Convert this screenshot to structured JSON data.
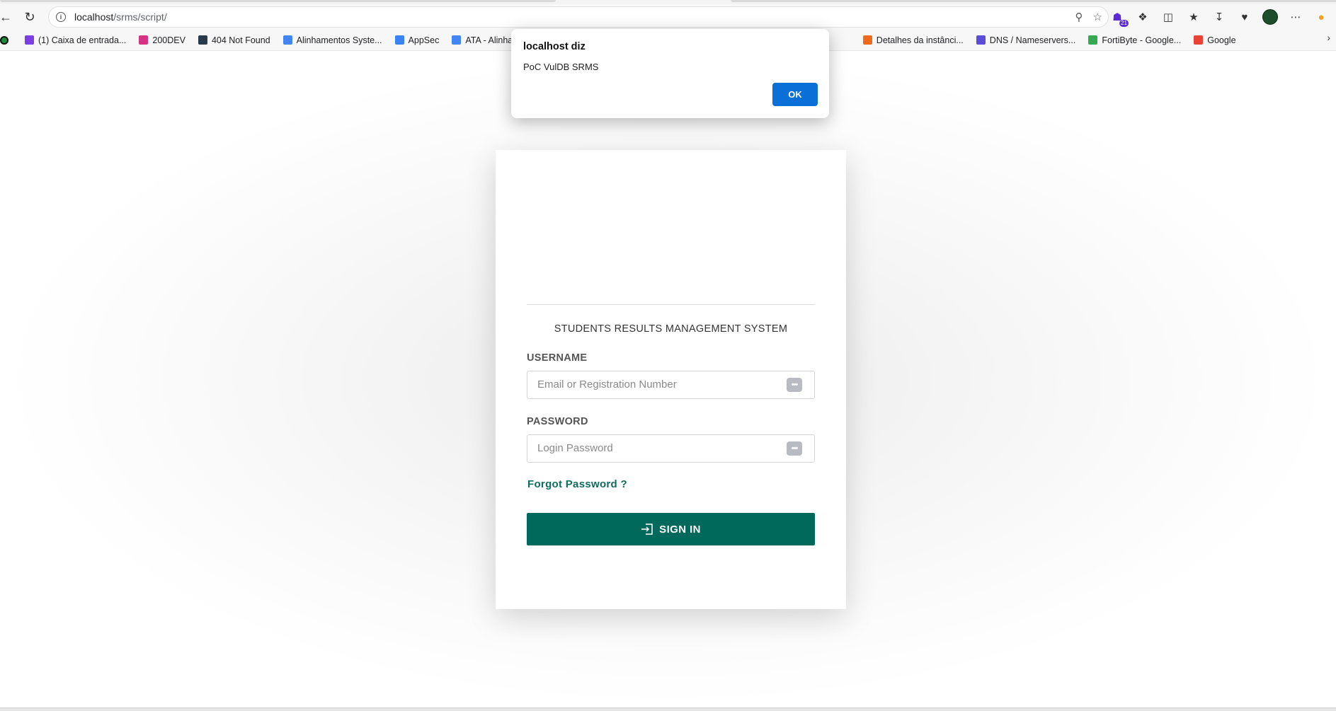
{
  "browser": {
    "url_host": "localhost",
    "url_path": "/srms/script/",
    "profile_badge": "21"
  },
  "bookmarks": [
    {
      "label": "(1) Caixa de entrada...",
      "color": "#7b3fe4"
    },
    {
      "label": "200DEV",
      "color": "#d63384"
    },
    {
      "label": "404 Not Found",
      "color": "#2b3a4a"
    },
    {
      "label": "Alinhamentos Syste...",
      "color": "#4285f4"
    },
    {
      "label": "AppSec",
      "color": "#3b82f6"
    },
    {
      "label": "ATA - Alinhamer",
      "color": "#4285f4"
    },
    {
      "label": "Detalhes da instânci...",
      "color": "#f06a1d"
    },
    {
      "label": "DNS / Nameservers...",
      "color": "#5b4bd6"
    },
    {
      "label": "FortiByte - Google...",
      "color": "#34a853"
    },
    {
      "label": "Google",
      "color": "#ea4335"
    }
  ],
  "alert": {
    "title": "localhost diz",
    "message": "PoC VulDB SRMS",
    "ok_label": "OK"
  },
  "login": {
    "system_title": "STUDENTS RESULTS MANAGEMENT SYSTEM",
    "username_label": "USERNAME",
    "username_placeholder": "Email or Registration Number",
    "password_label": "PASSWORD",
    "password_placeholder": "Login Password",
    "forgot_label": "Forgot Password ?",
    "signin_label": "SIGN IN"
  },
  "colors": {
    "primary": "#00695c",
    "link": "#0f6b5c",
    "alert_button": "#0a6fd6"
  }
}
